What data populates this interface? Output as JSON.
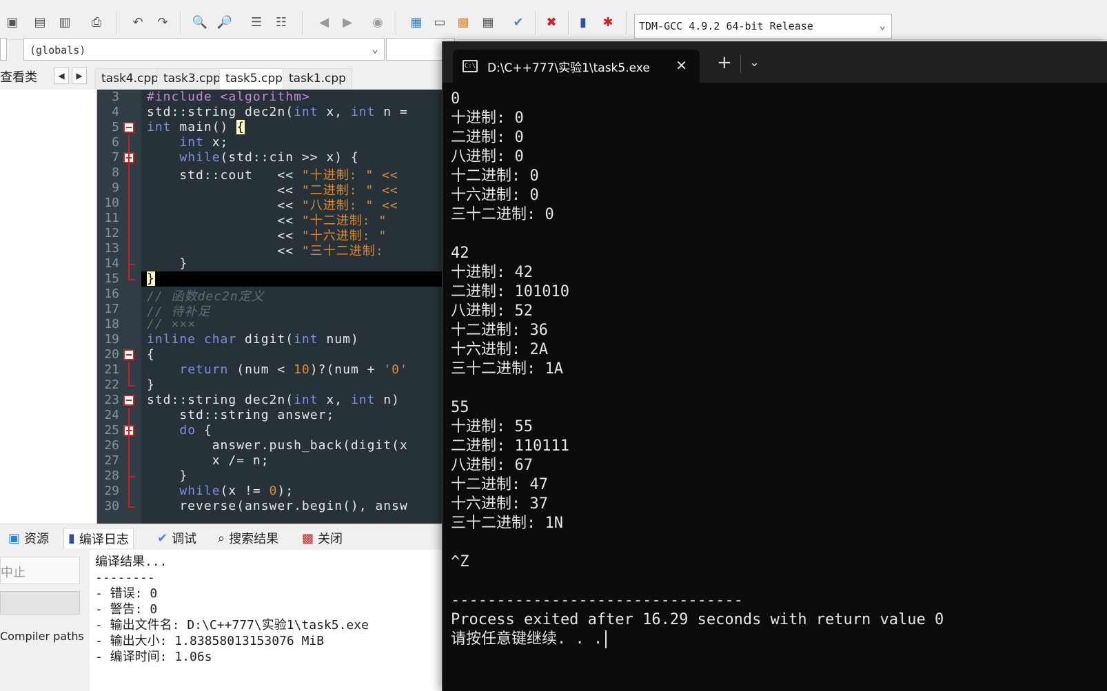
{
  "ide": {
    "compiler_select": "TDM-GCC 4.9.2 64-bit Release",
    "scope_select": "(globals)",
    "class_view_label": "查看类",
    "file_tabs": [
      "task4.cpp",
      "task3.cpp",
      "task5.cpp",
      "task1.cpp"
    ],
    "active_tab_index": 2,
    "code_lines": [
      {
        "n": "3"
      },
      {
        "n": "4"
      },
      {
        "n": "5"
      },
      {
        "n": "6"
      },
      {
        "n": "7"
      },
      {
        "n": "8"
      },
      {
        "n": "9"
      },
      {
        "n": "10"
      },
      {
        "n": "11"
      },
      {
        "n": "12"
      },
      {
        "n": "13"
      },
      {
        "n": "14"
      },
      {
        "n": "15"
      },
      {
        "n": "16"
      },
      {
        "n": "17"
      },
      {
        "n": "18"
      },
      {
        "n": "19"
      },
      {
        "n": "20"
      },
      {
        "n": "21"
      },
      {
        "n": "22"
      },
      {
        "n": "23"
      },
      {
        "n": "24"
      },
      {
        "n": "25"
      },
      {
        "n": "26"
      },
      {
        "n": "27"
      },
      {
        "n": "28"
      },
      {
        "n": "29"
      },
      {
        "n": "30"
      }
    ],
    "bottom_tabs": [
      {
        "label": "资源",
        "icon": "resources-icon"
      },
      {
        "label": "编译日志",
        "icon": "compile-log-icon"
      },
      {
        "label": "调试",
        "icon": "debug-check-icon"
      },
      {
        "label": "搜索结果",
        "icon": "search-results-icon"
      },
      {
        "label": "关闭",
        "icon": "close-panel-icon"
      }
    ],
    "stop_button": "中止",
    "compiler_paths_label": "Compiler paths",
    "compile_log": "编译结果...\n--------\n- 错误: 0\n- 警告: 0\n- 输出文件名: D:\\C++777\\实验1\\task5.exe\n- 输出大小: 1.83858013153076 MiB\n- 编译时间: 1.06s"
  },
  "terminal": {
    "tab_title": "D:\\C++777\\实验1\\task5.exe",
    "lines": [
      "0",
      "十进制: 0",
      "二进制: 0",
      "八进制: 0",
      "十二进制: 0",
      "十六进制: 0",
      "三十二进制: 0",
      "",
      "42",
      "十进制: 42",
      "二进制: 101010",
      "八进制: 52",
      "十二进制: 36",
      "十六进制: 2A",
      "三十二进制: 1A",
      "",
      "55",
      "十进制: 55",
      "二进制: 110111",
      "八进制: 67",
      "十二进制: 47",
      "十六进制: 37",
      "三十二进制: 1N",
      "",
      "^Z",
      "",
      "--------------------------------",
      "Process exited after 16.29 seconds with return value 0",
      "请按任意键继续. . ."
    ]
  }
}
